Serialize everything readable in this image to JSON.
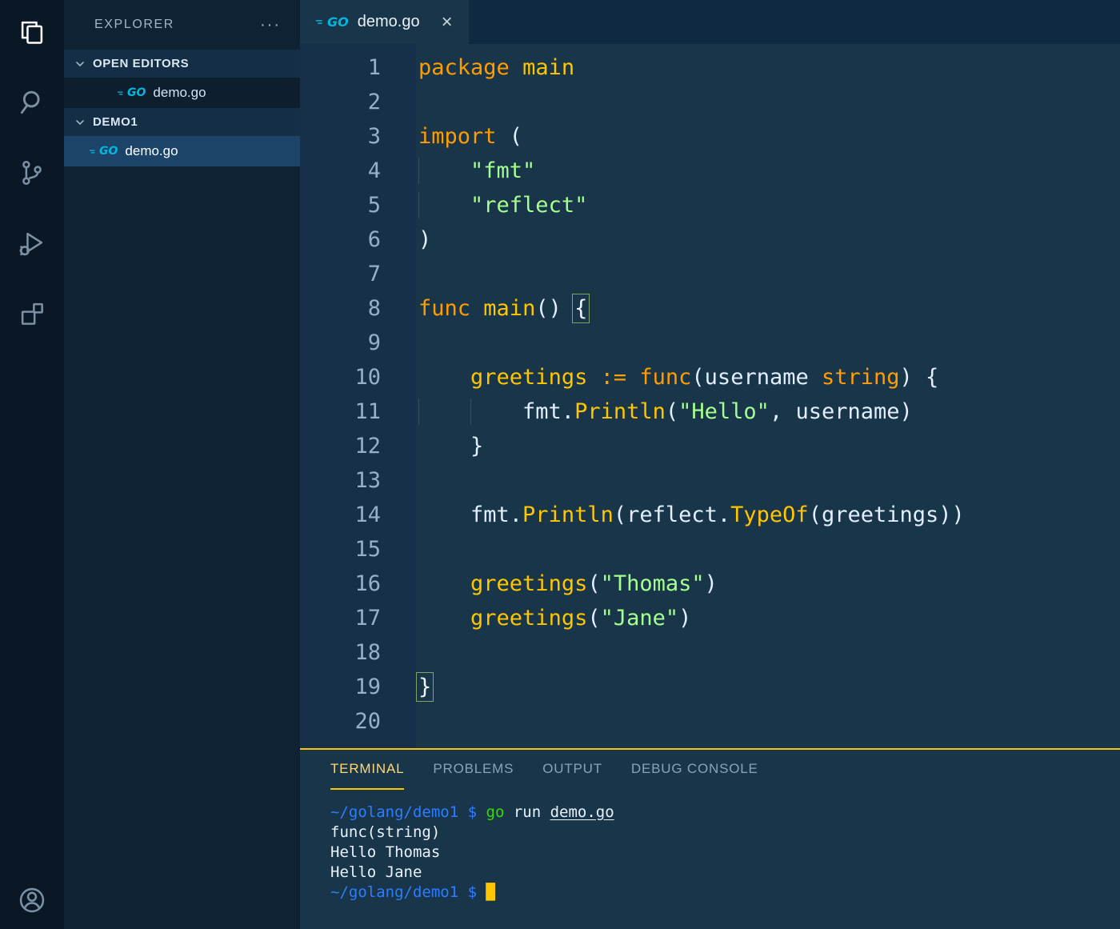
{
  "colors": {
    "accent": "#ffc600",
    "keyword_orange": "#ff9d00",
    "function_yellow": "#ffc600",
    "string_green": "#a5ff90",
    "editor_bg": "#193549",
    "terminal_blue": "#2d7dff",
    "terminal_green": "#3ad900",
    "go_icon_cyan": "#00b7e0"
  },
  "icons": {
    "go_label": "GO"
  },
  "activity_bar": {
    "items": [
      {
        "name": "activity-item-explorer",
        "icon": "files-icon",
        "active": true
      },
      {
        "name": "activity-item-search",
        "icon": "search-icon",
        "active": false
      },
      {
        "name": "activity-item-source-control",
        "icon": "source-control-icon",
        "active": false
      },
      {
        "name": "activity-item-run-debug",
        "icon": "run-debug-icon",
        "active": false
      },
      {
        "name": "activity-item-extensions",
        "icon": "extensions-icon",
        "active": false
      }
    ],
    "bottom_items": [
      {
        "name": "activity-item-account",
        "icon": "account-icon",
        "active": false
      }
    ]
  },
  "sidebar": {
    "title": "EXPLORER",
    "more_actions": "···",
    "sections": [
      {
        "label": "OPEN EDITORS",
        "items": [
          {
            "label": "demo.go",
            "icon": "go-file-icon",
            "selected": false
          }
        ]
      },
      {
        "label": "DEMO1",
        "items": [
          {
            "label": "demo.go",
            "icon": "go-file-icon",
            "selected": true
          }
        ]
      }
    ]
  },
  "editor": {
    "tabs": [
      {
        "label": "demo.go",
        "icon": "go-file-icon",
        "active": true,
        "close_label": "×"
      }
    ],
    "code_lines": [
      {
        "n": 1,
        "tokens": [
          [
            "kw",
            "package"
          ],
          [
            "tx",
            " "
          ],
          [
            "fn",
            "main"
          ]
        ]
      },
      {
        "n": 2,
        "tokens": []
      },
      {
        "n": 3,
        "tokens": [
          [
            "kw",
            "import"
          ],
          [
            "tx",
            " ("
          ]
        ]
      },
      {
        "n": 4,
        "guides": [
          0
        ],
        "tokens": [
          [
            "tx",
            "    "
          ],
          [
            "st",
            "\"fmt\""
          ]
        ]
      },
      {
        "n": 5,
        "guides": [
          0
        ],
        "tokens": [
          [
            "tx",
            "    "
          ],
          [
            "st",
            "\"reflect\""
          ]
        ]
      },
      {
        "n": 6,
        "tokens": [
          [
            "tx",
            ")"
          ]
        ]
      },
      {
        "n": 7,
        "tokens": []
      },
      {
        "n": 8,
        "tokens": [
          [
            "kw",
            "func"
          ],
          [
            "tx",
            " "
          ],
          [
            "fn",
            "main"
          ],
          [
            "tx",
            "() "
          ],
          [
            "bk",
            "{"
          ]
        ]
      },
      {
        "n": 9,
        "tokens": []
      },
      {
        "n": 10,
        "tokens": [
          [
            "tx",
            "    "
          ],
          [
            "fn",
            "greetings"
          ],
          [
            "tx",
            " "
          ],
          [
            "kw",
            ":="
          ],
          [
            "tx",
            " "
          ],
          [
            "kw",
            "func"
          ],
          [
            "tx",
            "(username "
          ],
          [
            "kw",
            "string"
          ],
          [
            "tx",
            ") {"
          ]
        ]
      },
      {
        "n": 11,
        "guides": [
          0,
          4
        ],
        "tokens": [
          [
            "tx",
            "        fmt."
          ],
          [
            "fn",
            "Println"
          ],
          [
            "tx",
            "("
          ],
          [
            "st",
            "\"Hello\""
          ],
          [
            "tx",
            ", username)"
          ]
        ]
      },
      {
        "n": 12,
        "tokens": [
          [
            "tx",
            "    }"
          ]
        ]
      },
      {
        "n": 13,
        "tokens": []
      },
      {
        "n": 14,
        "tokens": [
          [
            "tx",
            "    fmt."
          ],
          [
            "fn",
            "Println"
          ],
          [
            "tx",
            "(reflect."
          ],
          [
            "fn",
            "TypeOf"
          ],
          [
            "tx",
            "(greetings))"
          ]
        ]
      },
      {
        "n": 15,
        "tokens": []
      },
      {
        "n": 16,
        "tokens": [
          [
            "tx",
            "    "
          ],
          [
            "fn",
            "greetings"
          ],
          [
            "tx",
            "("
          ],
          [
            "st",
            "\"Thomas\""
          ],
          [
            "tx",
            ")"
          ]
        ]
      },
      {
        "n": 17,
        "tokens": [
          [
            "tx",
            "    "
          ],
          [
            "fn",
            "greetings"
          ],
          [
            "tx",
            "("
          ],
          [
            "st",
            "\"Jane\""
          ],
          [
            "tx",
            ")"
          ]
        ]
      },
      {
        "n": 18,
        "tokens": []
      },
      {
        "n": 19,
        "tokens": [
          [
            "bk",
            "}"
          ]
        ]
      },
      {
        "n": 20,
        "tokens": []
      }
    ]
  },
  "panel": {
    "tabs": [
      {
        "label": "TERMINAL",
        "active": true
      },
      {
        "label": "PROBLEMS",
        "active": false
      },
      {
        "label": "OUTPUT",
        "active": false
      },
      {
        "label": "DEBUG CONSOLE",
        "active": false
      }
    ],
    "terminal_lines": [
      {
        "tokens": [
          [
            "bl",
            "~/golang/demo1"
          ],
          [
            "tx",
            " "
          ],
          [
            "bl",
            "$"
          ],
          [
            "tx",
            " "
          ],
          [
            "gr",
            "go"
          ],
          [
            "tx",
            " run "
          ],
          [
            "un",
            "demo.go"
          ]
        ]
      },
      {
        "tokens": [
          [
            "tx",
            "func(string)"
          ]
        ]
      },
      {
        "tokens": [
          [
            "tx",
            "Hello Thomas"
          ]
        ]
      },
      {
        "tokens": [
          [
            "tx",
            "Hello Jane"
          ]
        ]
      },
      {
        "tokens": [
          [
            "bl",
            "~/golang/demo1"
          ],
          [
            "tx",
            " "
          ],
          [
            "bl",
            "$"
          ],
          [
            "tx",
            " "
          ],
          [
            "cu",
            "█"
          ]
        ]
      }
    ]
  }
}
